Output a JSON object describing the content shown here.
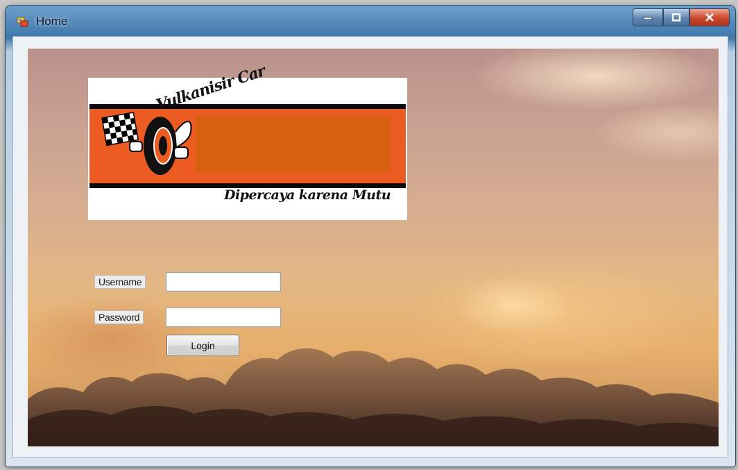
{
  "window": {
    "title": "Home",
    "controls": {
      "minimize": "minimize-icon",
      "maximize": "maximize-icon",
      "close": "close-icon"
    }
  },
  "logo": {
    "brand": "Vulkanisir Car",
    "tagline": "Dipercaya karena Mutu"
  },
  "login_form": {
    "username_label": "Username",
    "username_value": "",
    "password_label": "Password",
    "password_value": "",
    "login_button": "Login"
  },
  "colors": {
    "titlebar": "#4a7fb5",
    "close_button": "#c8462b",
    "logo_band": "#ec5b22",
    "logo_inner_box": "#d8610f"
  }
}
